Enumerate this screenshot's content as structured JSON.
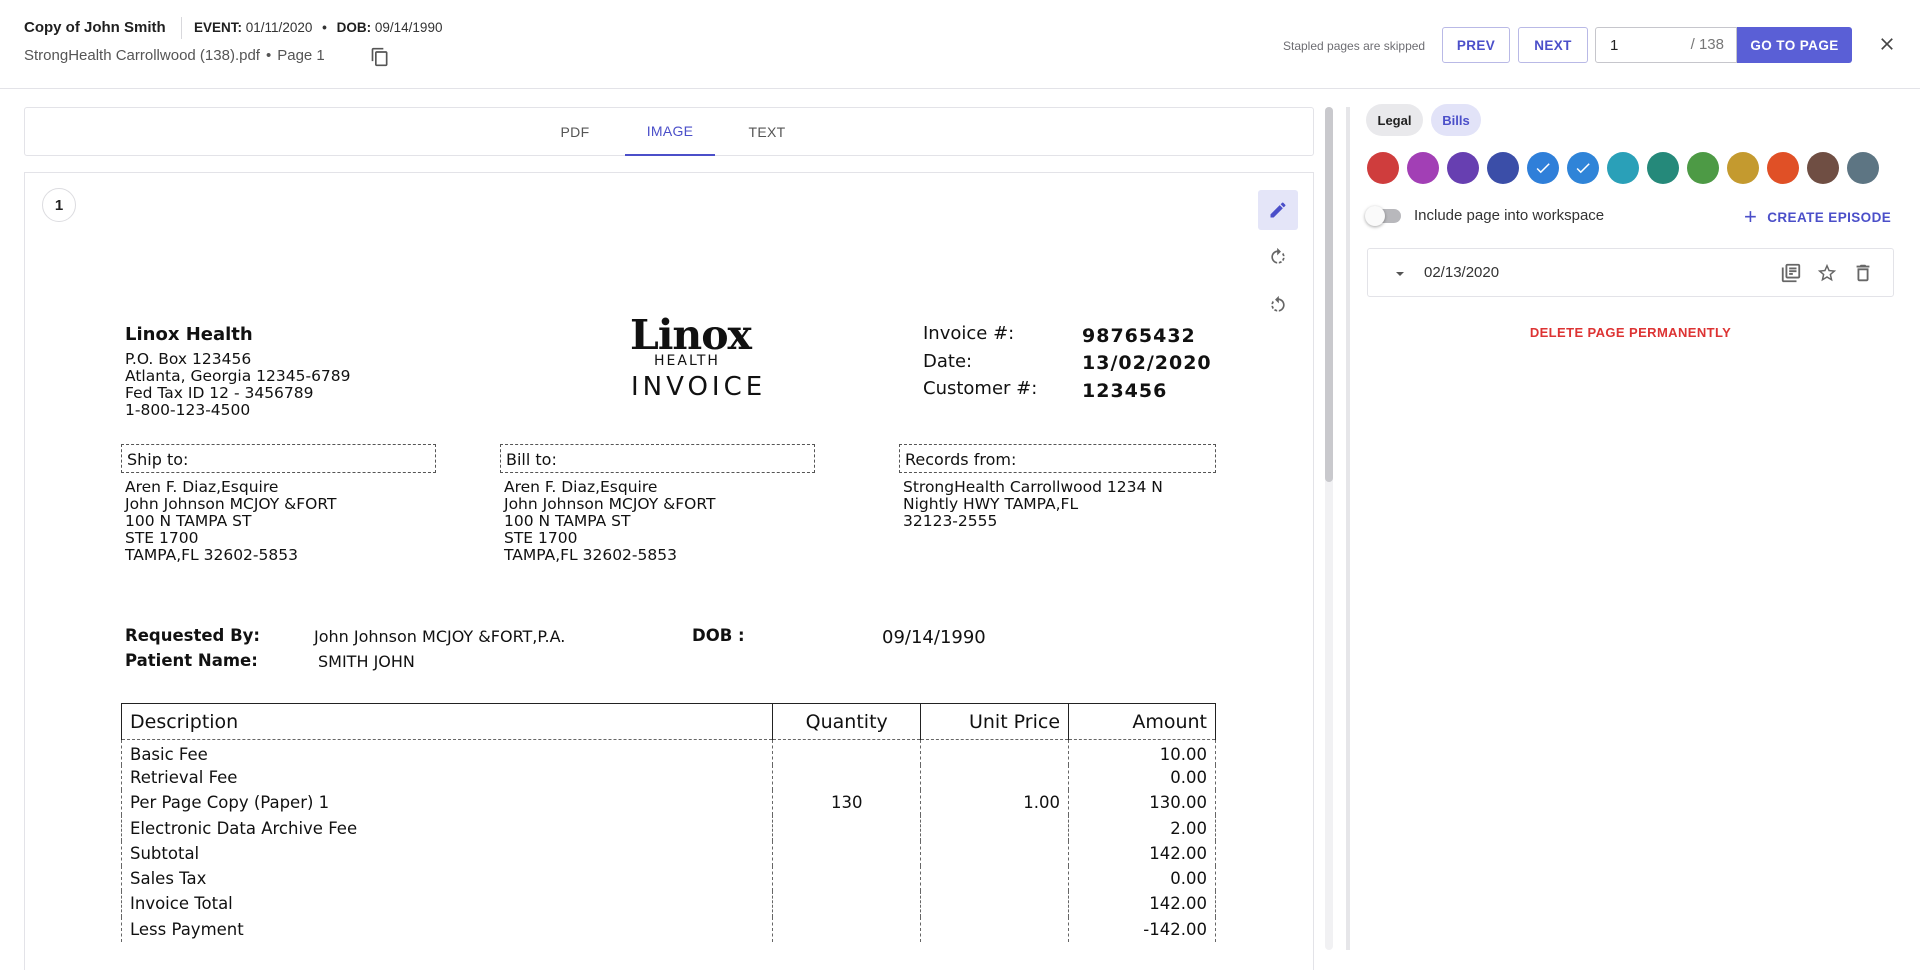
{
  "header": {
    "title": "Copy of John Smith",
    "event_label": "EVENT:",
    "event_value": "01/11/2020",
    "separator": "•",
    "dob_label": "DOB:",
    "dob_value": "09/14/1990",
    "file_name": "StrongHealth Carrollwood (138).pdf",
    "page_label": "Page 1",
    "stapled_note": "Stapled pages are skipped",
    "prev_label": "PREV",
    "next_label": "NEXT",
    "current_page": "1",
    "total_pages": "/ 138",
    "go_label": "GO TO PAGE"
  },
  "viewer": {
    "tabs": [
      {
        "label": "PDF",
        "active": false
      },
      {
        "label": "IMAGE",
        "active": true
      },
      {
        "label": "TEXT",
        "active": false
      }
    ],
    "page_number": "1"
  },
  "invoice": {
    "vendor_name": "Linox Health",
    "vendor_lines": [
      "P.O. Box 123456",
      "Atlanta, Georgia 12345-6789",
      "Fed Tax ID 12 - 3456789",
      "1-800-123-4500"
    ],
    "logo_main": "Linox",
    "logo_sub": "HEALTH",
    "logo_title": "INVOICE",
    "invoice_no_label": "Invoice #:",
    "invoice_no": "98765432",
    "date_label": "Date:",
    "date": "13/02/2020",
    "customer_label": "Customer #:",
    "customer_no": "123456",
    "ship_to_label": "Ship to:",
    "ship_to": [
      "Aren F. Diaz,Esquire",
      "John Johnson  MCJOY &FORT",
      "100 N TAMPA ST",
      "STE 1700",
      "TAMPA,FL 32602-5853"
    ],
    "bill_to_label": "Bill to:",
    "bill_to": [
      "Aren F. Diaz,Esquire",
      "John Johnson  MCJOY &FORT",
      "100 N TAMPA ST",
      "STE 1700",
      "TAMPA,FL 32602-5853"
    ],
    "records_from_label": "Records from:",
    "records_from": [
      "StrongHealth Carrollwood 1234 N",
      "Nightly HWY TAMPA,FL",
      "32123-2555"
    ],
    "requested_by_label": "Requested By:",
    "requested_by": "John Johnson  MCJOY &FORT,P.A.",
    "dob_label": "DOB :",
    "dob": "09/14/1990",
    "patient_label": "Patient Name:",
    "patient": "SMITH JOHN",
    "columns": [
      "Description",
      "Quantity",
      "Unit Price",
      "Amount"
    ],
    "rows": [
      [
        "Basic Fee",
        "",
        "",
        "10.00"
      ],
      [
        "Retrieval Fee",
        "",
        "",
        "0.00"
      ],
      [
        "Per Page Copy (Paper) 1",
        "130",
        "1.00",
        "130.00"
      ],
      [
        "Electronic Data Archive Fee",
        "",
        "",
        "2.00"
      ],
      [
        "Subtotal",
        "",
        "",
        "142.00"
      ],
      [
        "Sales Tax",
        "",
        "",
        "0.00"
      ],
      [
        "Invoice Total",
        "",
        "",
        "142.00"
      ],
      [
        "Less Payment",
        "",
        "",
        "-142.00"
      ]
    ]
  },
  "panel": {
    "chips": [
      {
        "label": "Legal",
        "active": false
      },
      {
        "label": "Bills",
        "active": true
      }
    ],
    "colors": [
      {
        "hex": "#cf3d3d",
        "selected": false
      },
      {
        "hex": "#a23fb5",
        "selected": false
      },
      {
        "hex": "#673fb1",
        "selected": false
      },
      {
        "hex": "#3b4ea8",
        "selected": false
      },
      {
        "hex": "#2f7fd9",
        "selected": true
      },
      {
        "hex": "#2f84d8",
        "selected": true
      },
      {
        "hex": "#2aa0b8",
        "selected": false
      },
      {
        "hex": "#25897a",
        "selected": false
      },
      {
        "hex": "#4d9a45",
        "selected": false
      },
      {
        "hex": "#c49a2f",
        "selected": false
      },
      {
        "hex": "#e05026",
        "selected": false
      },
      {
        "hex": "#6f4e43",
        "selected": false
      },
      {
        "hex": "#5d7583",
        "selected": false
      }
    ],
    "include_label": "Include page into workspace",
    "include_enabled": false,
    "create_episode_label": "CREATE EPISODE",
    "episode_date": "02/13/2020",
    "delete_label": "DELETE PAGE PERMANENTLY"
  }
}
